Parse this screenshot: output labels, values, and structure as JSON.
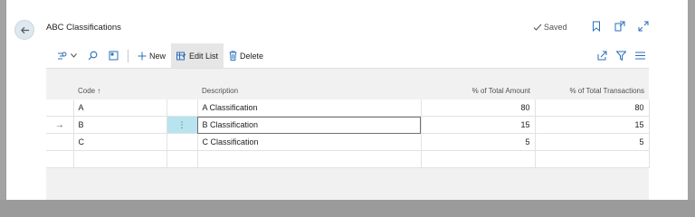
{
  "page": {
    "title": "ABC Classifications",
    "saved_label": "Saved"
  },
  "icons": {
    "back": "arrow-left-icon",
    "saved_check": "check-icon",
    "bookmark": "bookmark-icon",
    "open_new": "open-new-window-icon",
    "expand": "expand-icon"
  },
  "toolbar": {
    "search_icon": "search-icon",
    "new_label": "New",
    "edit_list_label": "Edit List",
    "delete_label": "Delete"
  },
  "table": {
    "columns": [
      "Code ↑",
      "Description",
      "% of Total Amount",
      "% of Total Transactions"
    ],
    "rows": [
      {
        "code": "A",
        "description": "A Classification",
        "amount": "80",
        "transactions": "80"
      },
      {
        "code": "B",
        "description": "B Classification",
        "amount": "15",
        "transactions": "15"
      },
      {
        "code": "C",
        "description": "C Classification",
        "amount": "5",
        "transactions": "5"
      }
    ],
    "selected_row_indicator": "→",
    "row_menu_glyph": "⋮"
  },
  "colors": {
    "accent": "#2a6fbb",
    "selected_cell": "#b7e4ee",
    "overlay": "#9b9b9b"
  }
}
